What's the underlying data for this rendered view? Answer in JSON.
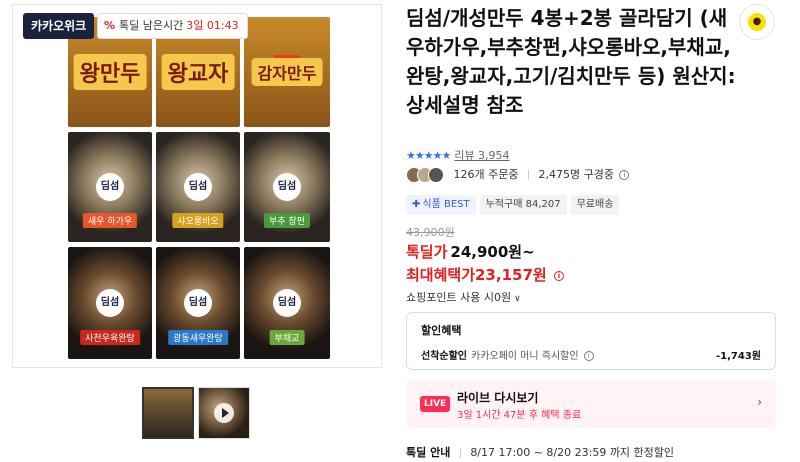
{
  "badges": {
    "kakao_week": "카카오위크",
    "deal_timer_prefix": "톡딜 남은시간",
    "deal_timer_value": "3일 01:43",
    "percent_glyph": "%"
  },
  "product_images": {
    "packages": [
      {
        "name": "왕만두",
        "tag": "개성"
      },
      {
        "name": "왕교자",
        "tag": "개성"
      },
      {
        "name": "감자만두",
        "tag": "개성"
      },
      {
        "brand": "딤섬",
        "flavor": "새우 하가우"
      },
      {
        "brand": "딤섬",
        "flavor": "샤오롱바오"
      },
      {
        "brand": "딤섬",
        "flavor": "부추 창펀"
      },
      {
        "brand": "딤섬",
        "flavor": "사천우육완탕"
      },
      {
        "brand": "딤섬",
        "flavor": "광동새우완탕"
      },
      {
        "brand": "딤섬",
        "flavor": "부채교"
      }
    ]
  },
  "product": {
    "title": "딤섬/개성만두 4봉+2봉 골라담기 (새우하가우,부추창펀,샤오롱바오,부채교,완탕,왕교자,고기/김치만두 등) 원산지: 상세설명 참조",
    "rating_stars": "★★★★★",
    "review_label": "리뷰 3,954",
    "orders": "126개 주문중",
    "viewers": "2,475명 구경중",
    "tags": [
      "식품 BEST",
      "누적구매 84,207",
      "무료배송"
    ],
    "original_price": "43,900원",
    "deal_price_label": "톡딜가",
    "deal_price_value": "24,900원~",
    "max_benefit_price": "최대혜택가23,157원",
    "points_label": "쇼핑포인트 사용 시0원"
  },
  "benefit": {
    "title": "할인혜택",
    "row_label": "선착순할인",
    "row_desc": "카카오페이 머니 즉시할인",
    "row_amount": "-1,743원"
  },
  "live": {
    "badge": "LIVE",
    "title": "라이브 다시보기",
    "subtitle": "3일 1시간 47분 후 혜택 종료"
  },
  "deal_notice": {
    "label": "톡딜 안내",
    "text": "8/17 17:00 ~ 8/20 23:59 까지 한정할인"
  },
  "colors": {
    "accent_red": "#e51e1e",
    "live_pink": "#ff2d55",
    "kakao_navy": "#1b2240",
    "kakao_yellow": "#fae100",
    "star_blue": "#3d6fe8"
  }
}
